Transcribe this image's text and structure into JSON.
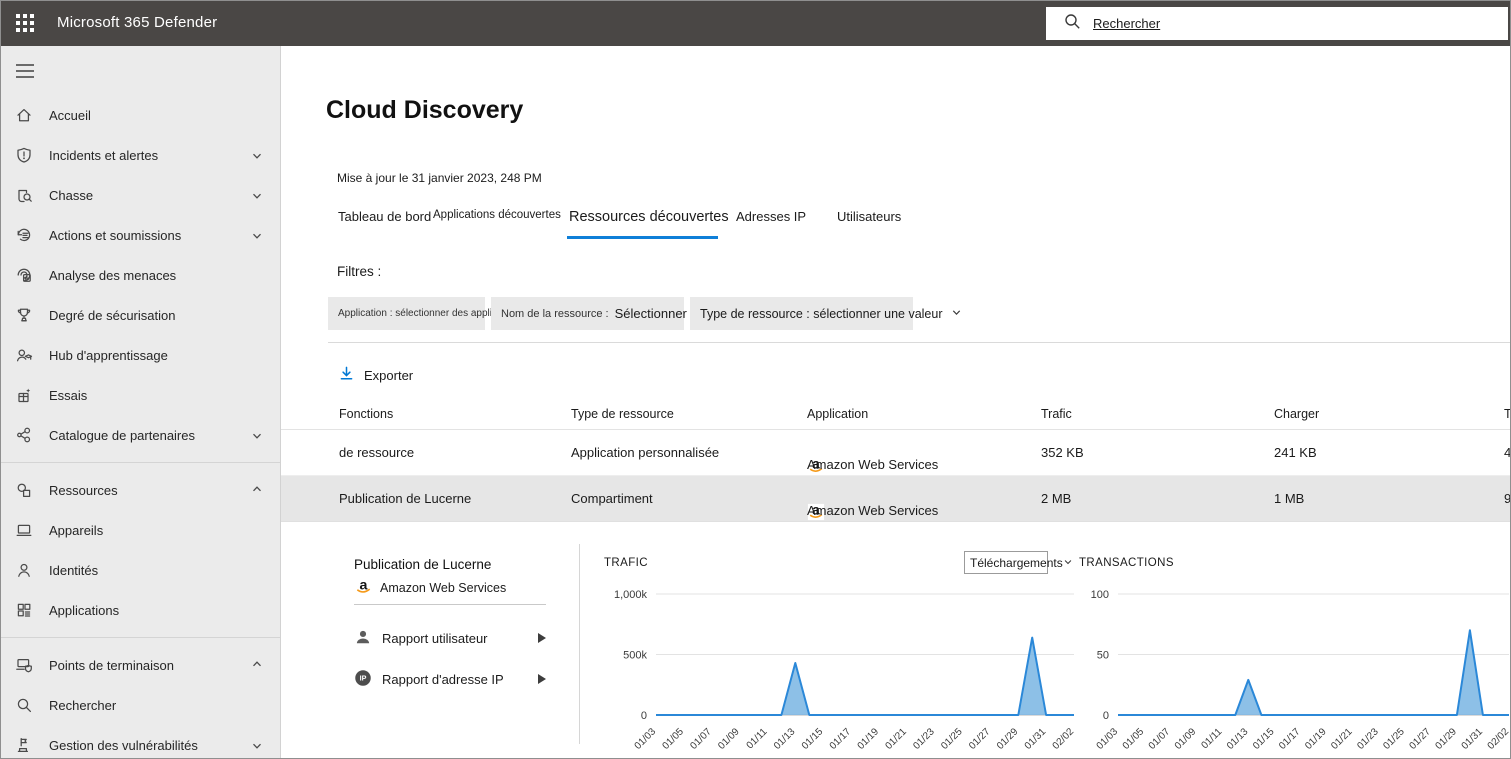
{
  "topbar": {
    "app_title": "Microsoft 365 Defender",
    "search_placeholder": "Rechercher"
  },
  "sidebar": {
    "items": [
      {
        "label": "Accueil",
        "icon": "home-icon",
        "chevron": null
      },
      {
        "label": "Incidents et alertes",
        "icon": "shield-alert-icon",
        "chevron": "down"
      },
      {
        "label": "Chasse",
        "icon": "hunting-icon",
        "chevron": "down"
      },
      {
        "label": "Actions et soumissions",
        "icon": "actions-history-icon",
        "chevron": "down"
      },
      {
        "label": "Analyse des menaces",
        "icon": "threat-analytics-icon",
        "chevron": null
      },
      {
        "label": "Degré de sécurisation",
        "icon": "secure-score-icon",
        "chevron": null
      },
      {
        "label": "Hub d'apprentissage",
        "icon": "learning-hub-icon",
        "chevron": null
      },
      {
        "label": "Essais",
        "icon": "trials-icon",
        "chevron": null
      },
      {
        "label": "Catalogue de partenaires",
        "icon": "partner-catalog-icon",
        "chevron": "down"
      },
      {
        "label": "Ressources",
        "icon": "assets-icon",
        "chevron": "up"
      },
      {
        "label": "Appareils",
        "icon": "devices-icon",
        "chevron": null
      },
      {
        "label": "Identités",
        "icon": "identities-icon",
        "chevron": null
      },
      {
        "label": "Applications",
        "icon": "applications-icon",
        "chevron": null
      },
      {
        "label": "Points de terminaison",
        "icon": "endpoints-icon",
        "chevron": "up"
      },
      {
        "label": "Rechercher",
        "icon": "search-icon",
        "chevron": null
      },
      {
        "label": "Gestion des vulnérabilités",
        "icon": "vulnerability-icon",
        "chevron": "down"
      }
    ]
  },
  "page": {
    "title": "Cloud Discovery",
    "updated": "Mise à jour le 31 janvier 2023, 248 PM"
  },
  "tabs": [
    {
      "label": "Tableau de bord",
      "active": false
    },
    {
      "label": "Applications découvertes",
      "active": false
    },
    {
      "label": "Ressources découvertes",
      "active": true
    },
    {
      "label": "Adresses IP",
      "active": false
    },
    {
      "label": "Utilisateurs",
      "active": false
    }
  ],
  "filters": {
    "label": "Filtres :",
    "chip_application": "Application : sélectionner des applications",
    "chip_resource_name_label": "Nom de la ressource :",
    "chip_resource_name_value": "Sélectionner",
    "chip_resource_type": "Type de ressource : sélectionner une valeur"
  },
  "toolbar": {
    "export_label": "Exporter"
  },
  "table": {
    "columns": [
      "Fonctions",
      "Type de ressource",
      "Application",
      "Trafic",
      "Charger",
      "T"
    ],
    "rows": [
      {
        "name": "de ressource",
        "type": "Application personnalisée",
        "app": "Amazon Web Services",
        "trafic": "352 KB",
        "charger": "241 KB",
        "extra": "4",
        "selected": false
      },
      {
        "name": "Publication de Lucerne",
        "type": "Compartiment",
        "app": "Amazon Web Services",
        "trafic": "2 MB",
        "charger": "1 MB",
        "extra": "9",
        "selected": true
      }
    ]
  },
  "detail": {
    "title": "Publication de Lucerne",
    "app": "Amazon Web Services",
    "user_report": "Rapport utilisateur",
    "ip_report": "Rapport d'adresse IP",
    "metric_dropdown": "Téléchargements"
  },
  "chart_data": [
    {
      "type": "area",
      "title": "TRAFIC",
      "x": [
        "01/03",
        "01/04",
        "01/05",
        "01/06",
        "01/07",
        "01/08",
        "01/09",
        "01/10",
        "01/11",
        "01/12",
        "01/13",
        "01/14",
        "01/15",
        "01/16",
        "01/17",
        "01/18",
        "01/19",
        "01/20",
        "01/21",
        "01/22",
        "01/23",
        "01/24",
        "01/25",
        "01/26",
        "01/27",
        "01/28",
        "01/29",
        "01/30",
        "01/31",
        "02/01",
        "02/02"
      ],
      "values": [
        0,
        0,
        0,
        0,
        0,
        0,
        0,
        0,
        0,
        0,
        430000,
        0,
        0,
        0,
        0,
        0,
        0,
        0,
        0,
        0,
        0,
        0,
        0,
        0,
        0,
        0,
        0,
        640000,
        0,
        0,
        0
      ],
      "ylim": [
        0,
        1000000
      ],
      "yticks": [
        {
          "v": 0,
          "label": "0"
        },
        {
          "v": 500000,
          "label": "500k"
        },
        {
          "v": 1000000,
          "label": "1,000k"
        }
      ],
      "xtick_every": 2,
      "grid": true,
      "legend": "none"
    },
    {
      "type": "area",
      "title": "TRANSACTIONS",
      "x": [
        "01/03",
        "01/04",
        "01/05",
        "01/06",
        "01/07",
        "01/08",
        "01/09",
        "01/10",
        "01/11",
        "01/12",
        "01/13",
        "01/14",
        "01/15",
        "01/16",
        "01/17",
        "01/18",
        "01/19",
        "01/20",
        "01/21",
        "01/22",
        "01/23",
        "01/24",
        "01/25",
        "01/26",
        "01/27",
        "01/28",
        "01/29",
        "01/30",
        "01/31",
        "02/01",
        "02/02"
      ],
      "values": [
        0,
        0,
        0,
        0,
        0,
        0,
        0,
        0,
        0,
        0,
        29,
        0,
        0,
        0,
        0,
        0,
        0,
        0,
        0,
        0,
        0,
        0,
        0,
        0,
        0,
        0,
        0,
        70,
        0,
        0,
        0
      ],
      "ylim": [
        0,
        100
      ],
      "yticks": [
        {
          "v": 0,
          "label": "0"
        },
        {
          "v": 50,
          "label": "50"
        },
        {
          "v": 100,
          "label": "100"
        }
      ],
      "xtick_every": 2,
      "grid": true,
      "legend": "none"
    }
  ],
  "colors": {
    "accent": "#0078d4",
    "topbar_bg": "#4a4745",
    "sidebar_bg": "#ebebeb",
    "selected_row_bg": "#e6e6e6",
    "chart_line": "#2b88d8",
    "chart_fill": "#79b5e3",
    "grid_line": "#e3e3e3",
    "axis_line": "#b5b5b5"
  }
}
